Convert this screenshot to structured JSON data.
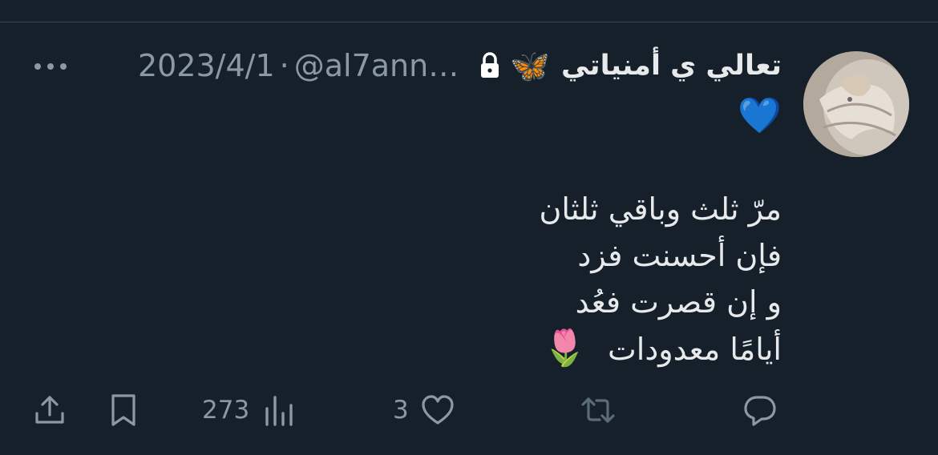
{
  "tweet": {
    "display_name": "تعالي ي أمنياتي",
    "name_emoji": "🦋",
    "name_emoji_line2": "💙",
    "handle": "@al7ann…",
    "separator": "·",
    "date": "2023/4/1",
    "lines": [
      "مرّ ثلث وباقي ثلثان",
      "فإن أحسنت فزد",
      "و إن قصرت فعُد",
      "أيامًا معدودات"
    ],
    "end_emoji": "🌷"
  },
  "actions": {
    "views_count": "273",
    "likes_count": "3"
  },
  "icons": {
    "more": "more-horizontal-icon",
    "lock": "lock-icon",
    "share": "share-icon",
    "bookmark": "bookmark-icon",
    "views": "views-analytics-icon",
    "like": "heart-icon",
    "retweet": "retweet-icon",
    "reply": "reply-icon"
  },
  "colors": {
    "background": "#15202b",
    "text": "#e7e9ea",
    "muted": "#8b98a5",
    "divider": "#38444d"
  }
}
